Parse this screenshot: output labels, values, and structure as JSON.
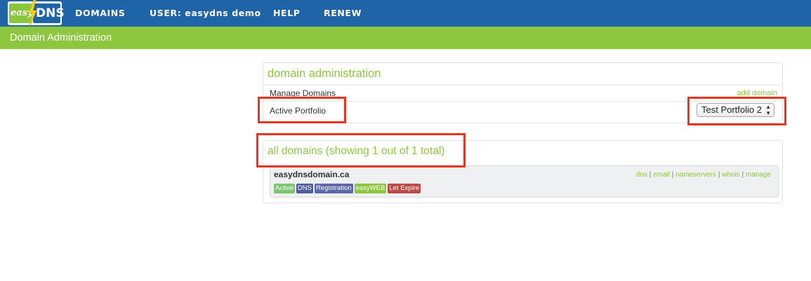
{
  "topnav": {
    "logo": {
      "easy": "easy",
      "dns": "DNS"
    },
    "items": [
      "DOMAINS",
      "USER: easydns demo",
      "HELP",
      "RENEW"
    ]
  },
  "subbar": {
    "title": "Domain Administration"
  },
  "admin_panel": {
    "title": "domain administration",
    "manage_label": "Manage Domains",
    "add_link": "add domain",
    "portfolio_label": "Active Portfolio",
    "portfolio_select": "Test Portfolio 2"
  },
  "domains_panel": {
    "title": "all domains (showing 1 out of 1 total)",
    "domains": [
      {
        "name": "easydnsdomain.ca",
        "links": [
          "dns",
          "email",
          "nameservers",
          "whois",
          "manage"
        ],
        "link_separator": "|",
        "tags": [
          {
            "label": "Active",
            "color": "#7ac56e"
          },
          {
            "label": "DNS",
            "color": "#4f5d9b"
          },
          {
            "label": "Registration",
            "color": "#5b67a6"
          },
          {
            "label": "easyWEB",
            "color": "#8dc63f"
          },
          {
            "label": "Let Expire",
            "color": "#b94a48"
          }
        ]
      }
    ]
  },
  "colors": {
    "nav_blue": "#1e64a7",
    "brand_green": "#8dc63f",
    "highlight_red": "#e8351f"
  }
}
